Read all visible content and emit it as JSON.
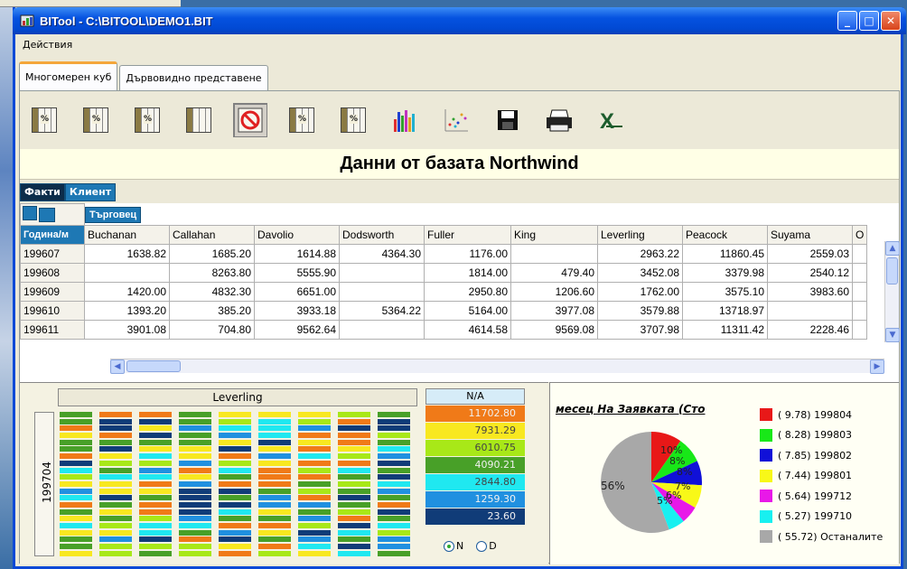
{
  "window": {
    "title": "BITool - C:\\BITOOL\\DEMO1.BIT",
    "minimize": "_",
    "maximize": "□",
    "close": "✕"
  },
  "menu": {
    "actions": "Действия"
  },
  "tabs": [
    {
      "label": "Многомерен куб"
    },
    {
      "label": "Дървовидно представене"
    }
  ],
  "toolbar": {
    "grid_icon_text": "%",
    "grid_icon_text_alt": "%"
  },
  "view_title": "Данни от базата Northwind",
  "chips": {
    "facts": "Факти",
    "client": "Клиент",
    "seller": "Търговец",
    "year_month": "Година/м"
  },
  "table": {
    "columns": [
      "Buchanan",
      "Callahan",
      "Davolio",
      "Dodsworth",
      "Fuller",
      "King",
      "Leverling",
      "Peacock",
      "Suyama",
      "O"
    ],
    "rows": [
      {
        "key": "199607",
        "cells": [
          "1638.82",
          "1685.20",
          "1614.88",
          "4364.30",
          "1176.00",
          "",
          "2963.22",
          "11860.45",
          "2559.03",
          ""
        ]
      },
      {
        "key": "199608",
        "cells": [
          "",
          "8263.80",
          "5555.90",
          "",
          "1814.00",
          "479.40",
          "3452.08",
          "3379.98",
          "2540.12",
          ""
        ]
      },
      {
        "key": "199609",
        "cells": [
          "1420.00",
          "4832.30",
          "6651.00",
          "",
          "2950.80",
          "1206.60",
          "1762.00",
          "3575.10",
          "3983.60",
          ""
        ]
      },
      {
        "key": "199610",
        "cells": [
          "1393.20",
          "385.20",
          "3933.18",
          "5364.22",
          "5164.00",
          "3977.08",
          "3579.88",
          "13718.97",
          "",
          ""
        ]
      },
      {
        "key": "199611",
        "cells": [
          "3901.08",
          "704.80",
          "9562.64",
          "",
          "4614.58",
          "9569.08",
          "3707.98",
          "11311.42",
          "2228.46",
          ""
        ]
      }
    ]
  },
  "heatmap": {
    "title": "Leverling",
    "ylabel": "199704",
    "legend_head": "N/A",
    "legend": [
      {
        "value": "11702.80",
        "color": "#f07a18"
      },
      {
        "value": "7931.29",
        "color": "#f8e820"
      },
      {
        "value": "6010.75",
        "color": "#a8e818"
      },
      {
        "value": "4090.21",
        "color": "#48a028"
      },
      {
        "value": "2844.80",
        "color": "#20e8f0"
      },
      {
        "value": "1259.30",
        "color": "#2090e0"
      },
      {
        "value": "23.60",
        "color": "#103c78"
      }
    ],
    "radio_n": "N",
    "radio_d": "D"
  },
  "pie": {
    "title": "месец На Заявката (Сто",
    "center_label": "56%",
    "slice_labels": [
      "10%",
      "8%",
      "8%",
      "7%",
      "6%",
      "5%"
    ],
    "legend": [
      {
        "label": "( 9.78) 199804",
        "color": "#e81818"
      },
      {
        "label": "( 8.28) 199803",
        "color": "#18e818"
      },
      {
        "label": "( 7.85) 199802",
        "color": "#1010d8"
      },
      {
        "label": "( 7.44) 199801",
        "color": "#f8f818"
      },
      {
        "label": "( 5.64) 199712",
        "color": "#e818e8"
      },
      {
        "label": "( 5.27) 199710",
        "color": "#18f0f0"
      },
      {
        "label": "( 55.72) Останалите",
        "color": "#a8a8a8"
      }
    ],
    "chart_data": {
      "type": "pie",
      "values": [
        9.78,
        8.28,
        7.85,
        7.44,
        5.64,
        5.27,
        55.72
      ],
      "categories": [
        "199804",
        "199803",
        "199802",
        "199801",
        "199712",
        "199710",
        "Останалите"
      ]
    }
  }
}
